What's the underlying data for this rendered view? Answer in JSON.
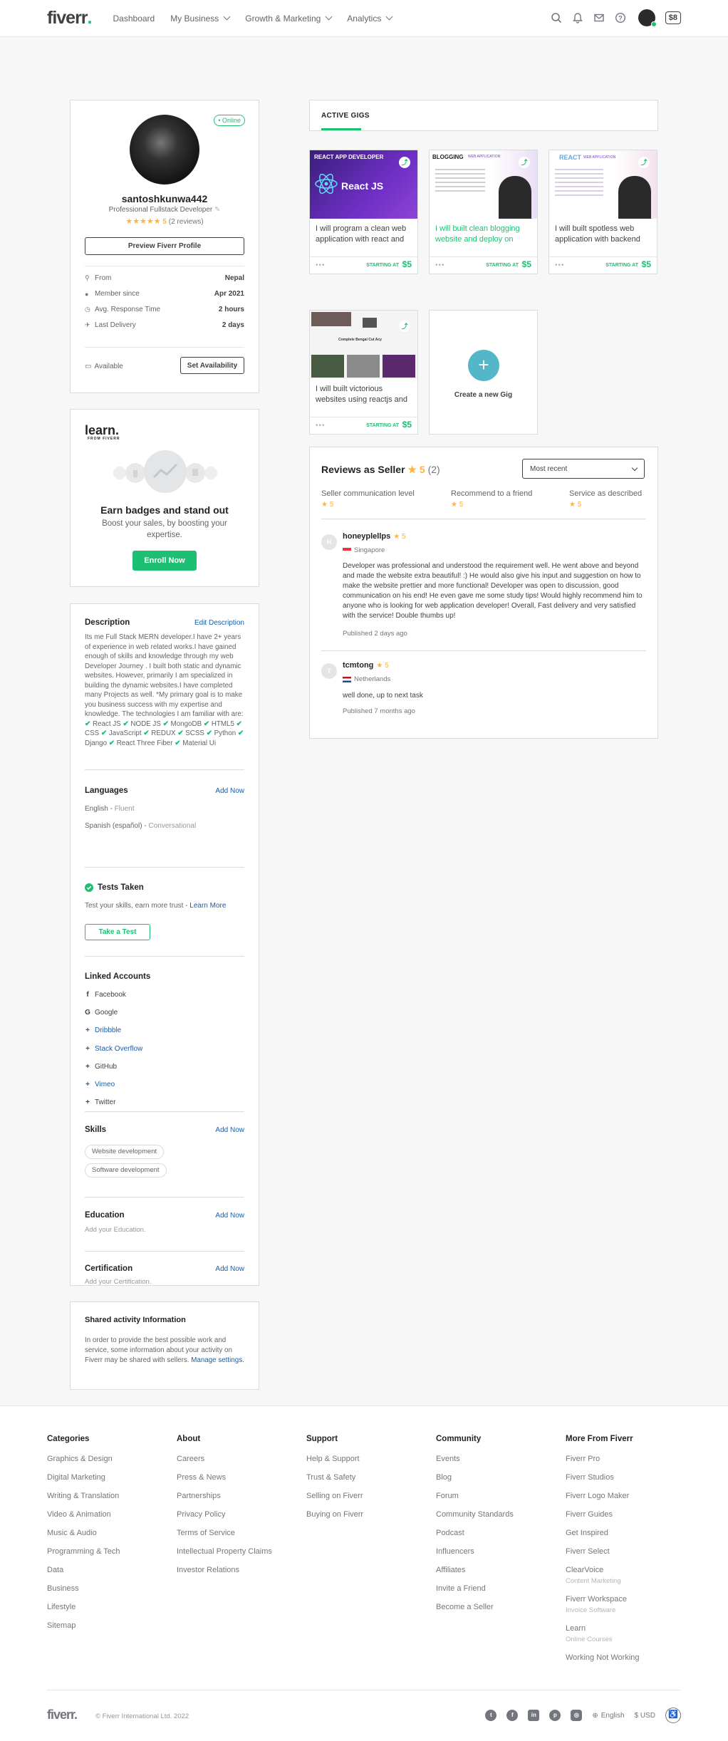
{
  "header": {
    "logo": "fiverr",
    "nav": [
      "Dashboard",
      "My Business",
      "Growth & Marketing",
      "Analytics"
    ],
    "balance": "$8",
    "icons": [
      "search-icon",
      "bell-icon",
      "envelope-icon",
      "help-icon"
    ]
  },
  "profile": {
    "status": "• Online",
    "username": "santoshkunwa442",
    "title": "Professional Fullstack Developer",
    "stars": "★★★★★",
    "rating": "5",
    "reviews": "(2 reviews)",
    "preview_button": "Preview Fiverr Profile",
    "stats": [
      {
        "label": "From",
        "value": "Nepal",
        "icon": "location-icon"
      },
      {
        "label": "Member since",
        "value": "Apr 2021",
        "icon": "user-icon"
      },
      {
        "label": "Avg. Response Time",
        "value": "2 hours",
        "icon": "clock-icon"
      },
      {
        "label": "Last Delivery",
        "value": "2 days",
        "icon": "plane-icon"
      }
    ],
    "availability_label": "Available",
    "set_availability": "Set Availability"
  },
  "learn": {
    "logo": "learn.",
    "logo_sub": "FROM FIVERR",
    "title": "Earn badges and stand out",
    "text": "Boost your sales, by boosting your expertise.",
    "button": "Enroll Now"
  },
  "about": {
    "description_title": "Description",
    "edit_description": "Edit Description",
    "description": "Its me Full Stack MERN developer.I have 2+ years of experience in web related works.I have gained enough of skills and knowledge through my web Developer Journey . I built both static and dynamic websites. However, primarily I am specialized in building the dynamic websites.I have completed many Projects as well. *My primary goal is to make you business success with my expertise and knowledge. The technologies I am familiar with are:",
    "technologies": [
      "React JS",
      "NODE JS",
      "MongoDB",
      "HTML5",
      "CSS",
      "JavaScript",
      "REDUX",
      "SCSS",
      "Python",
      "Django",
      "React Three Fiber",
      "Material Ui"
    ],
    "languages_title": "Languages",
    "add_now": "Add Now",
    "languages": [
      {
        "name": "English",
        "level": "Fluent"
      },
      {
        "name": "Spanish (español)",
        "level": "Conversational"
      }
    ],
    "tests_title": "Tests Taken",
    "tests_text": "Test your skills, earn more trust -",
    "learn_more": "Learn More",
    "take_test": "Take a Test",
    "linked_title": "Linked Accounts",
    "linked": [
      {
        "name": "Facebook",
        "icon": "facebook-icon",
        "linked": true
      },
      {
        "name": "Google",
        "icon": "google-icon",
        "linked": true
      },
      {
        "name": "Dribbble",
        "icon": "plus-icon",
        "linked": false
      },
      {
        "name": "Stack Overflow",
        "icon": "plus-icon",
        "linked": false
      },
      {
        "name": "GitHub",
        "icon": "plus-icon",
        "linked": true
      },
      {
        "name": "Vimeo",
        "icon": "plus-icon",
        "linked": false
      },
      {
        "name": "Twitter",
        "icon": "plus-icon",
        "linked": true
      }
    ],
    "skills_title": "Skills",
    "skills": [
      "Website development",
      "Software development"
    ],
    "education_title": "Education",
    "education_placeholder": "Add your Education.",
    "certification_title": "Certification",
    "certification_placeholder": "Add your Certification."
  },
  "shared": {
    "title": "Shared activity Information",
    "text": "In order to provide the best possible work and service, some information about your activity on Fiverr may be shared with sellers.",
    "link": "Manage settings."
  },
  "gigs": {
    "tab": "ACTIVE GIGS",
    "items": [
      {
        "title": "I will program a clean web application with react and",
        "starting": "STARTING AT",
        "price": "$5",
        "img_text": "REACT APP DEVELOPER",
        "img_sub": "React JS"
      },
      {
        "title": "I will built clean blogging website and deploy on",
        "starting": "STARTING AT",
        "price": "$5",
        "img_text": "BLOGGING",
        "img_sub": "WEB APPLICATION"
      },
      {
        "title": "I will built spotless web application with backend",
        "starting": "STARTING AT",
        "price": "$5",
        "img_text": "REACT",
        "img_sub": "WEB APPLICATION"
      },
      {
        "title": "I will built victorious websites using reactjs and",
        "starting": "STARTING AT",
        "price": "$5",
        "img_text": "Complete Bengal Cut Acy",
        "img_sub": ""
      }
    ],
    "new_gig": "Create a new Gig"
  },
  "reviews": {
    "title": "Reviews as Seller",
    "rating": "5",
    "count": "(2)",
    "sort": "Most recent",
    "breakdown": [
      {
        "label": "Seller communication level",
        "value": "5"
      },
      {
        "label": "Recommend to a friend",
        "value": "5"
      },
      {
        "label": "Service as described",
        "value": "5"
      }
    ],
    "items": [
      {
        "initial": "H",
        "name": "honeyplellps",
        "rating": "5",
        "country": "Singapore",
        "text": "Developer was professional and understood the requirement well. He went above and beyond and made the website extra beautiful! :) He would also give his input and suggestion on how to make the website prettier and more functional! Developer was open to discussion, good communication on his end! He even gave me some study tips! Would highly recommend him to anyone who is looking for web application developer! Overall, Fast delivery and very satisfied with the service! Double thumbs up!",
        "published": "Published 2 days ago"
      },
      {
        "initial": "T",
        "name": "tcmtong",
        "rating": "5",
        "country": "Netherlands",
        "text": "well done, up to next task",
        "published": "Published 7 months ago"
      }
    ]
  },
  "footer": {
    "columns": [
      {
        "title": "Categories",
        "items": [
          "Graphics & Design",
          "Digital Marketing",
          "Writing & Translation",
          "Video & Animation",
          "Music & Audio",
          "Programming & Tech",
          "Data",
          "Business",
          "Lifestyle",
          "Sitemap"
        ]
      },
      {
        "title": "About",
        "items": [
          "Careers",
          "Press & News",
          "Partnerships",
          "Privacy Policy",
          "Terms of Service",
          "Intellectual Property Claims",
          "Investor Relations"
        ]
      },
      {
        "title": "Support",
        "items": [
          "Help & Support",
          "Trust & Safety",
          "Selling on Fiverr",
          "Buying on Fiverr"
        ]
      },
      {
        "title": "Community",
        "items": [
          "Events",
          "Blog",
          "Forum",
          "Community Standards",
          "Podcast",
          "Influencers",
          "Affiliates",
          "Invite a Friend",
          "Become a Seller"
        ]
      },
      {
        "title": "More From Fiverr",
        "items": [
          "Fiverr Pro",
          "Fiverr Studios",
          "Fiverr Logo Maker",
          "Fiverr Guides",
          "Get Inspired",
          "Fiverr Select"
        ],
        "subitems": [
          {
            "name": "ClearVoice",
            "sub": "Content Marketing"
          },
          {
            "name": "Fiverr Workspace",
            "sub": "Invoice Software"
          },
          {
            "name": "Learn",
            "sub": "Online Courses"
          },
          {
            "name": "Working Not Working",
            "sub": ""
          }
        ]
      }
    ],
    "logo": "fiverr.",
    "copyright": "© Fiverr International Ltd. 2022",
    "language": "English",
    "currency": "$ USD",
    "social": [
      "twitter-icon",
      "facebook-icon",
      "linkedin-icon",
      "pinterest-icon",
      "instagram-icon"
    ]
  }
}
